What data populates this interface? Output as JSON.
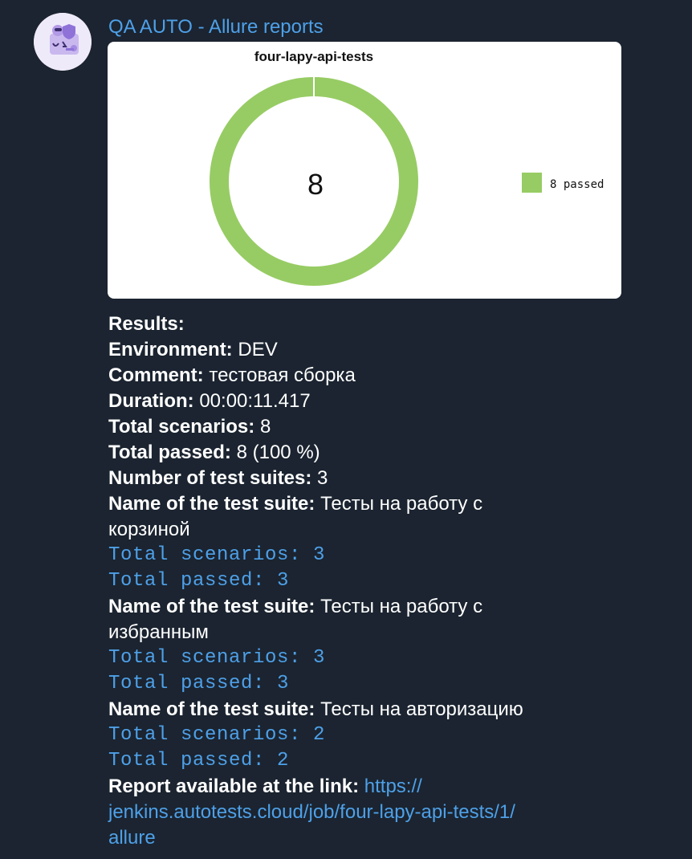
{
  "sender": {
    "name": "QA AUTO - Allure reports"
  },
  "chart_data": {
    "type": "pie",
    "title": "four-lapy-api-tests",
    "center_label": "8",
    "slices": [
      {
        "label": "8 passed",
        "value": 8,
        "color": "#97cc64"
      }
    ]
  },
  "results": {
    "heading": "Results:",
    "env_label": "Environment:",
    "env_value": "DEV",
    "comment_label": "Comment:",
    "comment_value": "тестовая сборка",
    "duration_label": "Duration:",
    "duration_value": "00:00:11.417",
    "total_label": "Total scenarios:",
    "total_value": "8",
    "passed_label": "Total passed:",
    "passed_value": "8 (100 %)",
    "suites_count_label": "Number of test suites:",
    "suites_count_value": "3",
    "suite_name_label": "Name of the test suite:",
    "suites": [
      {
        "name_line1": "Тесты на работу с",
        "name_line2": "корзиной",
        "scenarios": "Total scenarios: 3",
        "passed": "Total passed: 3"
      },
      {
        "name_line1": "Тесты на работу с",
        "name_line2": "избранным",
        "scenarios": "Total scenarios: 3",
        "passed": "Total passed: 3"
      },
      {
        "name_line1": "Тесты на авторизацию",
        "name_line2": "",
        "scenarios": "Total scenarios: 2",
        "passed": "Total passed: 2"
      }
    ],
    "report_label": "Report available at the link:",
    "report_url_line1": "https://",
    "report_url_line2": "jenkins.autotests.cloud/job/four-lapy-api-tests/1/",
    "report_url_line3": "allure"
  },
  "colors": {
    "background": "#1b2430",
    "accent": "#4ea0e8",
    "passed": "#97cc64"
  }
}
